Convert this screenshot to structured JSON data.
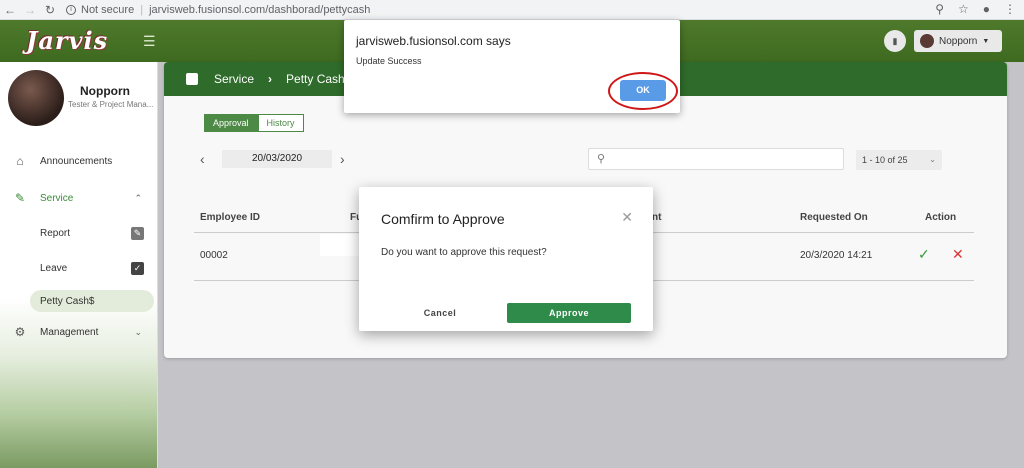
{
  "browser": {
    "security": "Not secure",
    "url": "jarvisweb.fusionsol.com/dashborad/pettycash"
  },
  "header": {
    "logo": "Jarvis",
    "user_name": "Nopporn"
  },
  "sidebar": {
    "profile_name": "Nopporn",
    "profile_role": "Tester & Project Mana...",
    "items": [
      {
        "label": "Announcements"
      },
      {
        "label": "Service"
      },
      {
        "label": "Report"
      },
      {
        "label": "Leave"
      },
      {
        "label": "Petty Cash"
      },
      {
        "label": "Management"
      }
    ]
  },
  "main": {
    "breadcrumb": [
      "Service",
      "Petty Cash"
    ],
    "tabs": [
      "Approval",
      "History"
    ],
    "date": "20/03/2020",
    "search_value": "",
    "pagination": "1 - 10 of 25",
    "columns": [
      "Employee ID",
      "Fu",
      "nt",
      "Requested On",
      "Action"
    ],
    "row": {
      "employee_id": "00002",
      "requested_on": "20/3/2020 14:21"
    }
  },
  "modal": {
    "title": "Comfirm to Approve",
    "message": "Do you want to approve this request?",
    "cancel": "Cancel",
    "approve": "Approve"
  },
  "alert": {
    "title": "jarvisweb.fusionsol.com says",
    "message": "Update Success",
    "ok": "OK"
  }
}
